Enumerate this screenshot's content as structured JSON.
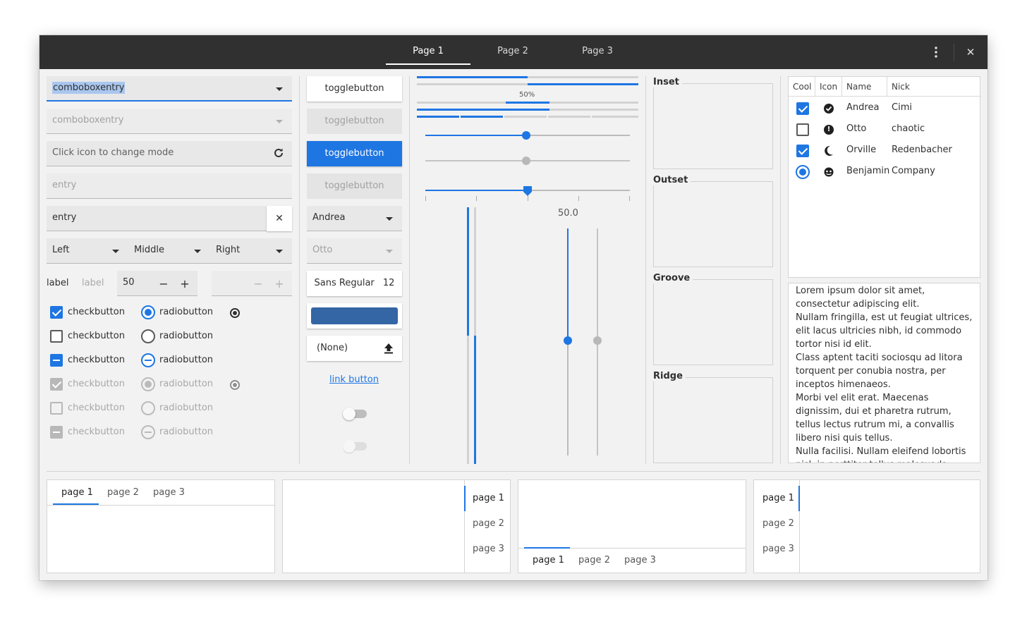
{
  "header": {
    "tabs": [
      {
        "label": "Page 1"
      },
      {
        "label": "Page 2"
      },
      {
        "label": "Page 3"
      }
    ],
    "menu_icon": "vertical-dots-icon",
    "close_icon": "close-icon"
  },
  "col1": {
    "combo1": "comboboxentry",
    "combo2": "comboboxentry",
    "entry_icon": "Click icon to change mode",
    "entry_dim": "entry",
    "entry_clear": "entry",
    "combos": [
      "Left",
      "Middle",
      "Right"
    ],
    "label1": "label",
    "label2": "label",
    "spin_value": "50",
    "checks": [
      {
        "label": "checkbutton",
        "state": "on"
      },
      {
        "label": "checkbutton",
        "state": "off"
      },
      {
        "label": "checkbutton",
        "state": "mixed"
      },
      {
        "label": "checkbutton",
        "state": "on-disabled"
      },
      {
        "label": "checkbutton",
        "state": "off-disabled"
      },
      {
        "label": "checkbutton",
        "state": "mixed-disabled"
      }
    ],
    "radios": [
      {
        "label": "radiobutton",
        "state": "on"
      },
      {
        "label": "radiobutton",
        "state": "off"
      },
      {
        "label": "radiobutton",
        "state": "mixed"
      },
      {
        "label": "radiobutton",
        "state": "on-disabled"
      },
      {
        "label": "radiobutton",
        "state": "off-disabled"
      },
      {
        "label": "radiobutton",
        "state": "mixed-disabled"
      }
    ]
  },
  "col2": {
    "toggles": [
      "togglebutton",
      "togglebutton",
      "togglebutton",
      "togglebutton"
    ],
    "combo_andrea": "Andrea",
    "combo_otto": "Otto",
    "font_name": "Sans Regular",
    "font_size": "12",
    "color_hex": "#3465a4",
    "file_button": "(None)",
    "link": "link button",
    "switch1": false,
    "switch2": false
  },
  "col3": {
    "progress_label": "50%",
    "progress": 0.5,
    "scale_value_label": "50.0",
    "scale_value": 50
  },
  "frames": [
    {
      "label": "Inset"
    },
    {
      "label": "Outset"
    },
    {
      "label": "Groove"
    },
    {
      "label": "Ridge"
    }
  ],
  "tree": {
    "columns": [
      "Cool",
      "Icon",
      "Name",
      "Nick"
    ],
    "rows": [
      {
        "cool": "check",
        "icon": "check-circle-icon",
        "name": "Andrea",
        "nick": "Cimi"
      },
      {
        "cool": "uncheck",
        "icon": "exclamation-circle-icon",
        "name": "Otto",
        "nick": "chaotic"
      },
      {
        "cool": "check",
        "icon": "moon-icon",
        "name": "Orville",
        "nick": "Redenbacher"
      },
      {
        "cool": "radio",
        "icon": "face-icon",
        "name": "Benjamin",
        "nick": "Company"
      }
    ]
  },
  "textview": {
    "text": "Lorem ipsum dolor sit amet, consectetur adipiscing elit.\nNullam fringilla, est ut feugiat ultrices, elit lacus ultricies nibh, id commodo tortor nisi id elit.\nClass aptent taciti sociosqu ad litora torquent per conubia nostra, per inceptos himenaeos.\nMorbi vel elit erat. Maecenas dignissim, dui et pharetra rutrum, tellus lectus rutrum mi, a convallis libero nisi quis tellus.\nNulla facilisi. Nullam eleifend lobortis nisl, in porttitor tellus malesuada vitae."
  },
  "notebooks": [
    {
      "tabs": [
        "page 1",
        "page 2",
        "page 3"
      ]
    },
    {
      "tabs": [
        "page 1",
        "page 2",
        "page 3"
      ]
    },
    {
      "tabs": [
        "page 1",
        "page 2",
        "page 3"
      ]
    },
    {
      "tabs": [
        "page 1",
        "page 2",
        "page 3"
      ]
    }
  ],
  "colors": {
    "accent": "#1e76e3",
    "header": "#303030",
    "window": "#f2f2f2"
  }
}
